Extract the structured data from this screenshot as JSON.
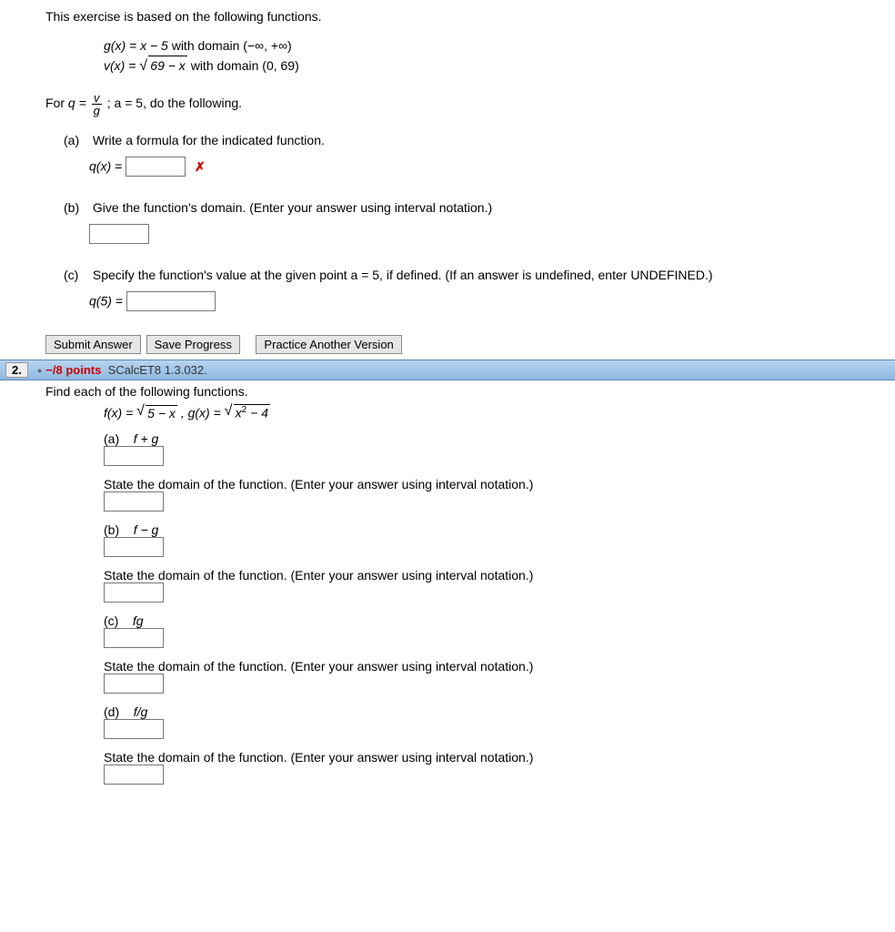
{
  "q1": {
    "intro": "This exercise is based on the following functions.",
    "g_def_lhs": "g(x) = x − 5",
    "g_def_domain": " with domain (−∞, +∞)",
    "v_def_lhs": "v(x) = ",
    "v_def_radicand": "69 − x",
    "v_def_domain": " with domain (0, 69)",
    "for_q_prefix": "For ",
    "for_q_q": "q = ",
    "for_q_a": "; a = 5, do the following.",
    "frac_num": "v",
    "frac_den": "g",
    "a": {
      "label": "(a)",
      "text": "Write a formula for the indicated function.",
      "eq_lhs": "q(x) = ",
      "mark": "✗"
    },
    "b": {
      "label": "(b)",
      "text": "Give the function's domain. (Enter your answer using interval notation.)"
    },
    "c": {
      "label": "(c)",
      "text": "Specify the function's value at the given point a = 5, if defined. (If an answer is undefined, enter UNDEFINED.)",
      "eq_lhs": "q(5) = "
    },
    "buttons": {
      "submit": "Submit Answer",
      "save": "Save Progress",
      "practice": "Practice Another Version"
    }
  },
  "bar": {
    "num": "2.",
    "points": "−/8 points",
    "ref": "SCalcET8 1.3.032."
  },
  "q2": {
    "intro": "Find each of the following functions.",
    "f_lhs": "f(x) = ",
    "f_radicand": "5 − x",
    "g_lhs": ",  g(x) = ",
    "g_radicand": "x",
    "g_exp": "2",
    "g_tail": " − 4",
    "domain_text": "State the domain of the function. (Enter your answer using interval notation.)",
    "a": {
      "label": "(a)",
      "fn": "f + g"
    },
    "b": {
      "label": "(b)",
      "fn": "f − g"
    },
    "c": {
      "label": "(c)",
      "fn": "fg"
    },
    "d": {
      "label": "(d)",
      "fn": "f/g"
    }
  }
}
